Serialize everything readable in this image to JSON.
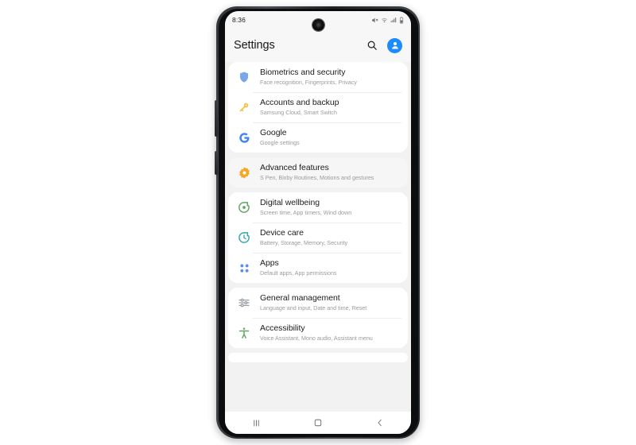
{
  "device": {
    "name": "samsung-galaxy-note-phone-frame",
    "frame_color": "#2f3337"
  },
  "status_bar": {
    "time": "8:36",
    "icons": [
      "mute-icon",
      "wifi-icon",
      "signal-icon",
      "battery-icon"
    ]
  },
  "header": {
    "title": "Settings",
    "search_icon": "search-icon",
    "avatar_icon": "account-avatar-icon",
    "accent_color": "#1a8cff"
  },
  "sections": [
    {
      "highlight": false,
      "items": [
        {
          "icon": "shield-icon",
          "icon_color": "#7ba7e8",
          "title": "Biometrics and security",
          "subtitle": "Face recognition, Fingerprints, Privacy"
        },
        {
          "icon": "key-icon",
          "icon_color": "#f2c14a",
          "title": "Accounts and backup",
          "subtitle": "Samsung Cloud, Smart Switch"
        },
        {
          "icon": "google-g-icon",
          "icon_color": "#4285f4",
          "title": "Google",
          "subtitle": "Google settings"
        }
      ]
    },
    {
      "highlight": true,
      "items": [
        {
          "icon": "advanced-features-icon",
          "icon_color": "#f5a623",
          "title": "Advanced features",
          "subtitle": "S Pen, Bixby Routines, Motions and gestures"
        }
      ]
    },
    {
      "highlight": false,
      "items": [
        {
          "icon": "digital-wellbeing-icon",
          "icon_color": "#5fa85f",
          "title": "Digital wellbeing",
          "subtitle": "Screen time, App timers, Wind down"
        },
        {
          "icon": "device-care-icon",
          "icon_color": "#35a7a7",
          "title": "Device care",
          "subtitle": "Battery, Storage, Memory, Security"
        },
        {
          "icon": "apps-grid-icon",
          "icon_color": "#5b8def",
          "title": "Apps",
          "subtitle": "Default apps, App permissions"
        }
      ]
    },
    {
      "highlight": false,
      "items": [
        {
          "icon": "sliders-icon",
          "icon_color": "#9aa0a6",
          "title": "General management",
          "subtitle": "Language and input, Date and time, Reset"
        },
        {
          "icon": "accessibility-icon",
          "icon_color": "#5fa85f",
          "title": "Accessibility",
          "subtitle": "Voice Assistant, Mono audio, Assistant menu"
        }
      ]
    }
  ],
  "nav_bar": {
    "recents_label": "recents-icon",
    "home_label": "home-icon",
    "back_label": "back-icon"
  }
}
